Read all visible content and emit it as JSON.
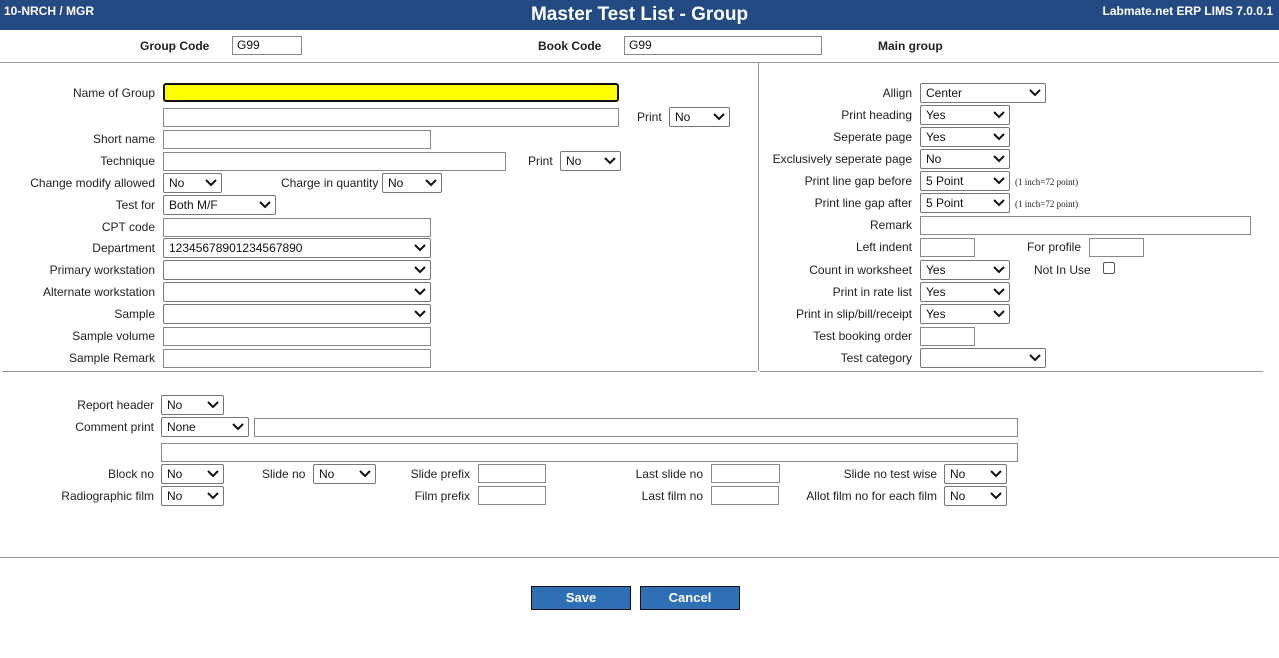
{
  "header": {
    "user": "10-NRCH / MGR",
    "title": "Master Test List - Group",
    "app": "Labmate.net ERP LIMS 7.0.0.1"
  },
  "top": {
    "group_code_label": "Group Code",
    "group_code_value": "G99",
    "book_code_label": "Book Code",
    "book_code_value": "G99",
    "main_group_label": "Main group"
  },
  "left": {
    "name_of_group_label": "Name of Group",
    "name_of_group_value": "",
    "print_label": "Print",
    "print_value": "No",
    "short_name_label": "Short name",
    "technique_label": "Technique",
    "technique_print_label": "Print",
    "technique_print_value": "No",
    "change_modify_label": "Change modify allowed",
    "change_modify_value": "No",
    "charge_qty_label": "Charge in quantity",
    "charge_qty_value": "No",
    "test_for_label": "Test for",
    "test_for_value": "Both M/F",
    "cpt_code_label": "CPT code",
    "department_label": "Department",
    "department_value": "12345678901234567890",
    "primary_ws_label": "Primary workstation",
    "alternate_ws_label": "Alternate workstation",
    "sample_label": "Sample",
    "sample_volume_label": "Sample volume",
    "sample_remark_label": "Sample Remark"
  },
  "right": {
    "allign_label": "Allign",
    "allign_value": "Center",
    "print_heading_label": "Print heading",
    "print_heading_value": "Yes",
    "seperate_page_label": "Seperate page",
    "seperate_page_value": "Yes",
    "excl_seperate_label": "Exclusively seperate page",
    "excl_seperate_value": "No",
    "gap_before_label": "Print line gap before",
    "gap_before_value": "5 Point",
    "gap_after_label": "Print line gap after",
    "gap_after_value": "5 Point",
    "gap_note": "(1 inch=72 point)",
    "remark_label": "Remark",
    "left_indent_label": "Left indent",
    "for_profile_label": "For profile",
    "count_ws_label": "Count in worksheet",
    "count_ws_value": "Yes",
    "not_in_use_label": "Not In Use",
    "rate_list_label": "Print in rate list",
    "rate_list_value": "Yes",
    "slip_label": "Print in slip/bill/receipt",
    "slip_value": "Yes",
    "booking_order_label": "Test booking order",
    "category_label": "Test category",
    "category_value": ""
  },
  "bottom": {
    "report_header_label": "Report header",
    "report_header_value": "No",
    "comment_print_label": "Comment print",
    "comment_print_value": "None",
    "block_no_label": "Block no",
    "block_no_value": "No",
    "slide_no_label": "Slide no",
    "slide_no_value": "No",
    "slide_prefix_label": "Slide prefix",
    "last_slide_label": "Last slide no",
    "slide_testwise_label": "Slide no test wise",
    "slide_testwise_value": "No",
    "radiographic_label": "Radiographic film",
    "radiographic_value": "No",
    "film_prefix_label": "Film prefix",
    "last_film_label": "Last film no",
    "allot_film_label": "Allot film no for each film",
    "allot_film_value": "No"
  },
  "buttons": {
    "save": "Save",
    "cancel": "Cancel"
  },
  "colors": {
    "header_bg": "#234a82",
    "button_bg": "#2f6fb5",
    "highlight_input": "#ffff00"
  }
}
